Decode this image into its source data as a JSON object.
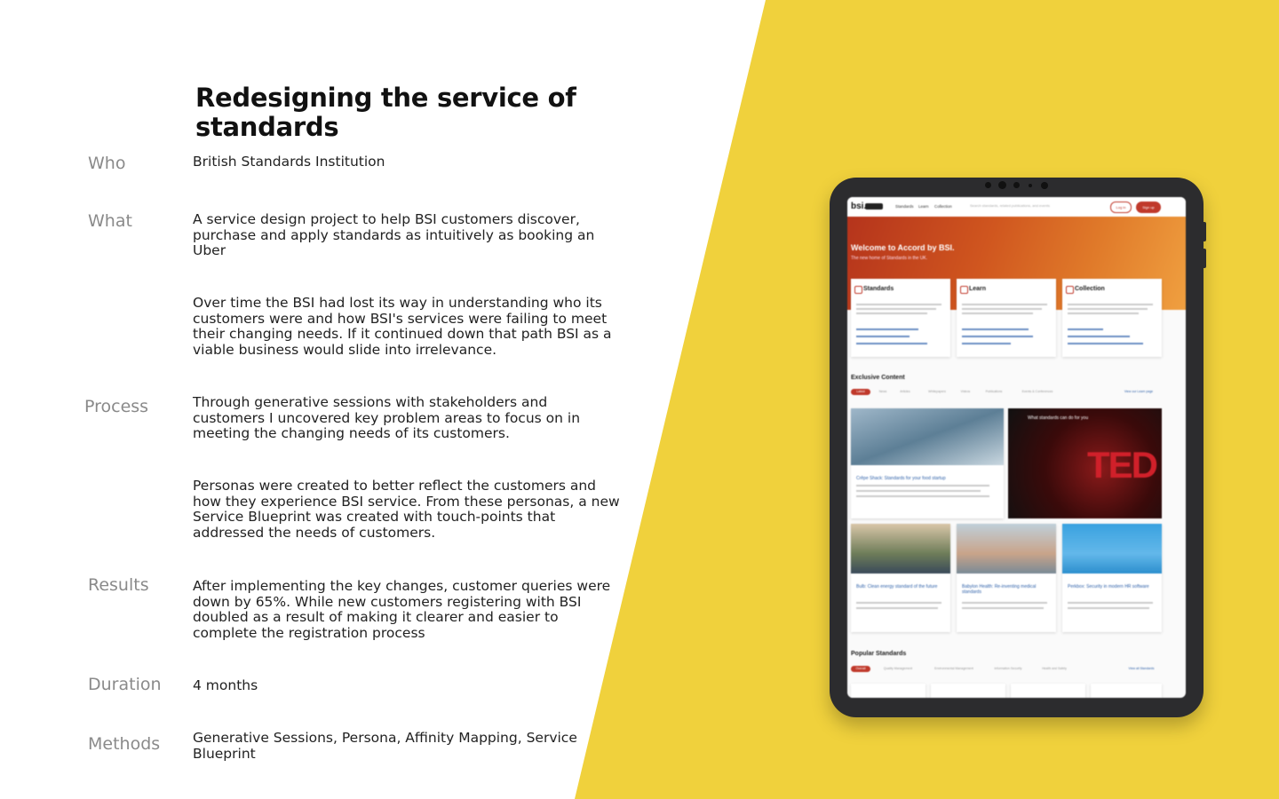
{
  "title": "Redesigning the service of standards",
  "rows": {
    "who": {
      "label": "Who",
      "text": "British Standards Institution"
    },
    "what": {
      "label": "What",
      "text": "A service design project to help BSI customers discover, purchase and apply standards as intuitively as booking an Uber",
      "text2": "Over time the BSI had lost its way in understanding who its customers were and how BSI's services were failing to meet their changing needs. If it continued down that path BSI as a viable business would slide into irrelevance."
    },
    "process": {
      "label": "Process",
      "text": "Through generative sessions with stakeholders and customers I uncovered key problem areas to focus on in meeting the changing needs of its customers.",
      "text2": "Personas were created to better reflect the customers and how they experience BSI service. From these personas, a new Service Blueprint was created with touch-points that addressed the needs of customers."
    },
    "results": {
      "label": "Results",
      "text": "After implementing the key changes, customer queries were down by 65%. While new customers registering with BSI doubled as a result of making it clearer and easier to complete the registration process"
    },
    "duration": {
      "label": "Duration",
      "text": "4 months"
    },
    "methods": {
      "label": "Methods",
      "text": "Generative Sessions, Persona, Affinity Mapping, Service Blueprint"
    }
  },
  "colors": {
    "background_accent": "#f0d13c",
    "brand_red": "#c0392b"
  },
  "mockup": {
    "logo": "bsi.",
    "nav": [
      "Standards",
      "Learn",
      "Collection"
    ],
    "search_placeholder": "Search standards, related publications, and events",
    "login": "Log in",
    "signup": "Sign up",
    "hero_title": "Welcome to Accord by BSI.",
    "hero_subtitle": "The new home of Standards in the UK.",
    "cards": [
      "Standards",
      "Learn",
      "Collection"
    ],
    "exclusive_title": "Exclusive Content",
    "exclusive_tabs": [
      "Latest",
      "News",
      "Articles",
      "Whitepapers",
      "Videos",
      "Publications",
      "Events & Conferences"
    ],
    "exclusive_link": "View our Learn page",
    "tiles": [
      "Crêpe Shack: Standards for your food startup",
      "Bulb: Clean energy standard of the future",
      "Babylon Health: Re-inventing medical standards",
      "Perkbox: Security in modern HR software"
    ],
    "video_title": "What standards can do for you",
    "video_brand": "TED",
    "popular_title": "Popular Standards",
    "popular_tabs": [
      "Overall",
      "Quality Management",
      "Environmental Management",
      "Information Security",
      "Health and Safety"
    ],
    "popular_link": "View all Standards"
  }
}
